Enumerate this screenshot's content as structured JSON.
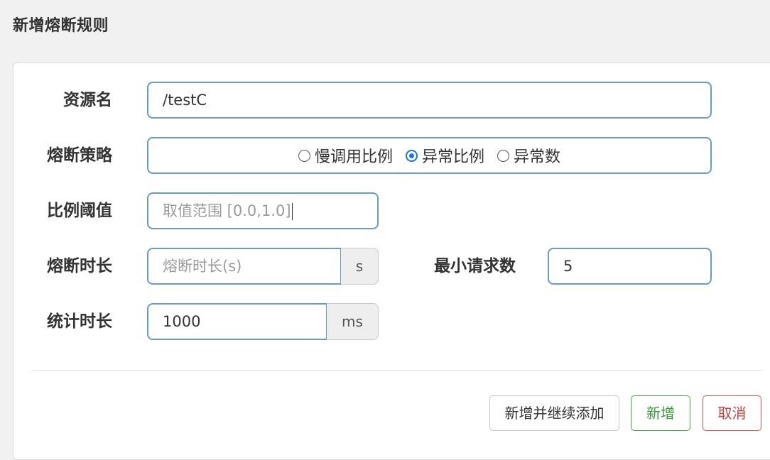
{
  "dialog": {
    "title": "新增熔断规则"
  },
  "form": {
    "resource": {
      "label": "资源名",
      "value": "/testC"
    },
    "strategy": {
      "label": "熔断策略",
      "options": [
        "慢调用比例",
        "异常比例",
        "异常数"
      ],
      "selected": "异常比例"
    },
    "ratio": {
      "label": "比例阈值",
      "placeholder": "取值范围 [0.0,1.0]"
    },
    "time_window": {
      "label": "熔断时长",
      "placeholder": "熔断时长(s)",
      "unit": "s"
    },
    "min_request": {
      "label": "最小请求数",
      "value": "5"
    },
    "stat_interval": {
      "label": "统计时长",
      "value": "1000",
      "unit": "ms"
    }
  },
  "footer": {
    "add_continue_label": "新增并继续添加",
    "add_label": "新增",
    "cancel_label": "取消"
  },
  "colors": {
    "input_border": "#6a9bd0",
    "radio_checked": "#1a73e8",
    "success": "#47a447",
    "danger": "#d9534f"
  }
}
